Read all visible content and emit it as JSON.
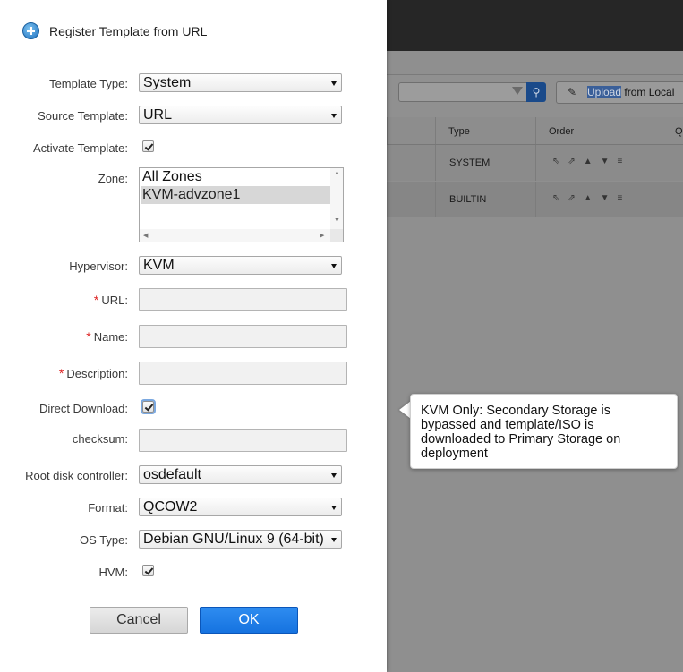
{
  "background": {
    "upload_button": {
      "highlighted": "Upload",
      "rest": " from Local"
    },
    "table": {
      "columns": [
        "Type",
        "Order",
        "Qu"
      ],
      "rows": [
        {
          "type": "SYSTEM"
        },
        {
          "type": "BUILTIN"
        }
      ]
    }
  },
  "dialog": {
    "title": "Register Template from URL",
    "fields": {
      "template_type": {
        "label": "Template Type:",
        "value": "System"
      },
      "source_template": {
        "label": "Source Template:",
        "value": "URL"
      },
      "activate_template": {
        "label": "Activate Template:",
        "checked": true
      },
      "zone": {
        "label": "Zone:",
        "options": [
          "All Zones",
          "KVM-advzone1"
        ],
        "selected": "KVM-advzone1"
      },
      "hypervisor": {
        "label": "Hypervisor:",
        "value": "KVM"
      },
      "url": {
        "label": "URL:",
        "required_mark": "*",
        "value": ""
      },
      "name": {
        "label": "Name:",
        "required_mark": "*",
        "value": ""
      },
      "description": {
        "label": "Description:",
        "required_mark": "*",
        "value": ""
      },
      "direct_download": {
        "label": "Direct Download:",
        "checked": true
      },
      "checksum": {
        "label": "checksum:",
        "value": ""
      },
      "root_disk_controller": {
        "label": "Root disk controller:",
        "value": "osdefault"
      },
      "format": {
        "label": "Format:",
        "value": "QCOW2"
      },
      "os_type": {
        "label": "OS Type:",
        "value": "Debian GNU/Linux 9 (64-bit)"
      },
      "hvm": {
        "label": "HVM:",
        "checked": true
      }
    },
    "buttons": {
      "cancel": "Cancel",
      "ok": "OK"
    }
  },
  "tooltip": {
    "text": "KVM Only: Secondary Storage is bypassed and template/ISO is downloaded to Primary Storage on deployment"
  },
  "colors": {
    "primary_button": "#1673e0",
    "required_mark": "#dd2222",
    "top_bar": "#262626"
  }
}
